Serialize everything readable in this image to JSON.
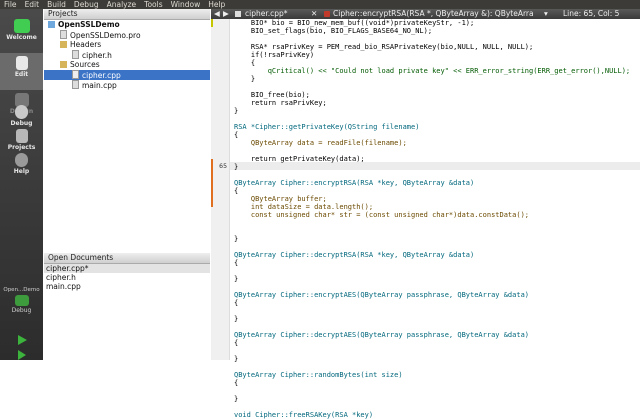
{
  "menu": [
    "File",
    "Edit",
    "Build",
    "Debug",
    "Analyze",
    "Tools",
    "Window",
    "Help"
  ],
  "modes": [
    {
      "label": "Welcome",
      "icon": "qt-logo-icon"
    },
    {
      "label": "Edit",
      "icon": "edit-icon",
      "active": true
    },
    {
      "label": "Design",
      "icon": "design-icon"
    },
    {
      "label": "Debug",
      "icon": "debug-icon"
    },
    {
      "label": "Projects",
      "icon": "projects-icon"
    },
    {
      "label": "Help",
      "icon": "help-icon"
    }
  ],
  "target": {
    "label": "Open...Demo",
    "sublabel": "Debug"
  },
  "projects_panel": {
    "title": "Projects",
    "tree": [
      {
        "label": "OpenSSLDemo"
      },
      {
        "label": "OpenSSLDemo.pro"
      },
      {
        "label": "Headers"
      },
      {
        "label": "cipher.h"
      },
      {
        "label": "Sources"
      },
      {
        "label": "cipher.cpp"
      },
      {
        "label": "main.cpp"
      }
    ]
  },
  "open_documents": {
    "title": "Open Documents",
    "items": [
      "cipher.cpp*",
      "cipher.h",
      "main.cpp"
    ]
  },
  "editor": {
    "tab": "cipher.cpp*",
    "symbol": "Cipher::encryptRSA(RSA *, QByteArray &): QByteArra",
    "position": "Line: 65, Col: 5",
    "current_line": "65",
    "lines": [
      "    BIO* bio = BIO_new_mem_buf((void*)privateKeyStr, -1);",
      "    BIO_set_flags(bio, BIO_FLAGS_BASE64_NO_NL);",
      "",
      "    RSA* rsaPrivKey = PEM_read_bio_RSAPrivateKey(bio,NULL, NULL, NULL);",
      "    if(!rsaPrivKey)",
      "    {",
      "        qCritical() << \"Could not load private key\" << ERR_error_string(ERR_get_error(),NULL);",
      "    }",
      "",
      "    BIO_free(bio);",
      "    return rsaPrivKey;",
      "}",
      "",
      "RSA *Cipher::getPrivateKey(QString filename)",
      "{",
      "    QByteArray data = readFile(filename);",
      "",
      "    return getPrivateKey(data);",
      "}",
      "",
      "QByteArray Cipher::encryptRSA(RSA *key, QByteArray &data)",
      "{",
      "    QByteArray buffer;",
      "    int dataSize = data.length();",
      "    const unsigned char* str = (const unsigned char*)data.constData();",
      "",
      "",
      "}",
      "",
      "QByteArray Cipher::decryptRSA(RSA *key, QByteArray &data)",
      "{",
      "",
      "}",
      "",
      "QByteArray Cipher::encryptAES(QByteArray passphrase, QByteArray &data)",
      "{",
      "",
      "}",
      "",
      "QByteArray Cipher::decryptAES(QByteArray passphrase, QByteArray &data)",
      "{",
      "",
      "}",
      "",
      "QByteArray Cipher::randomBytes(int size)",
      "{",
      "",
      "}",
      "",
      "void Cipher::freeRSAKey(RSA *key)"
    ]
  }
}
